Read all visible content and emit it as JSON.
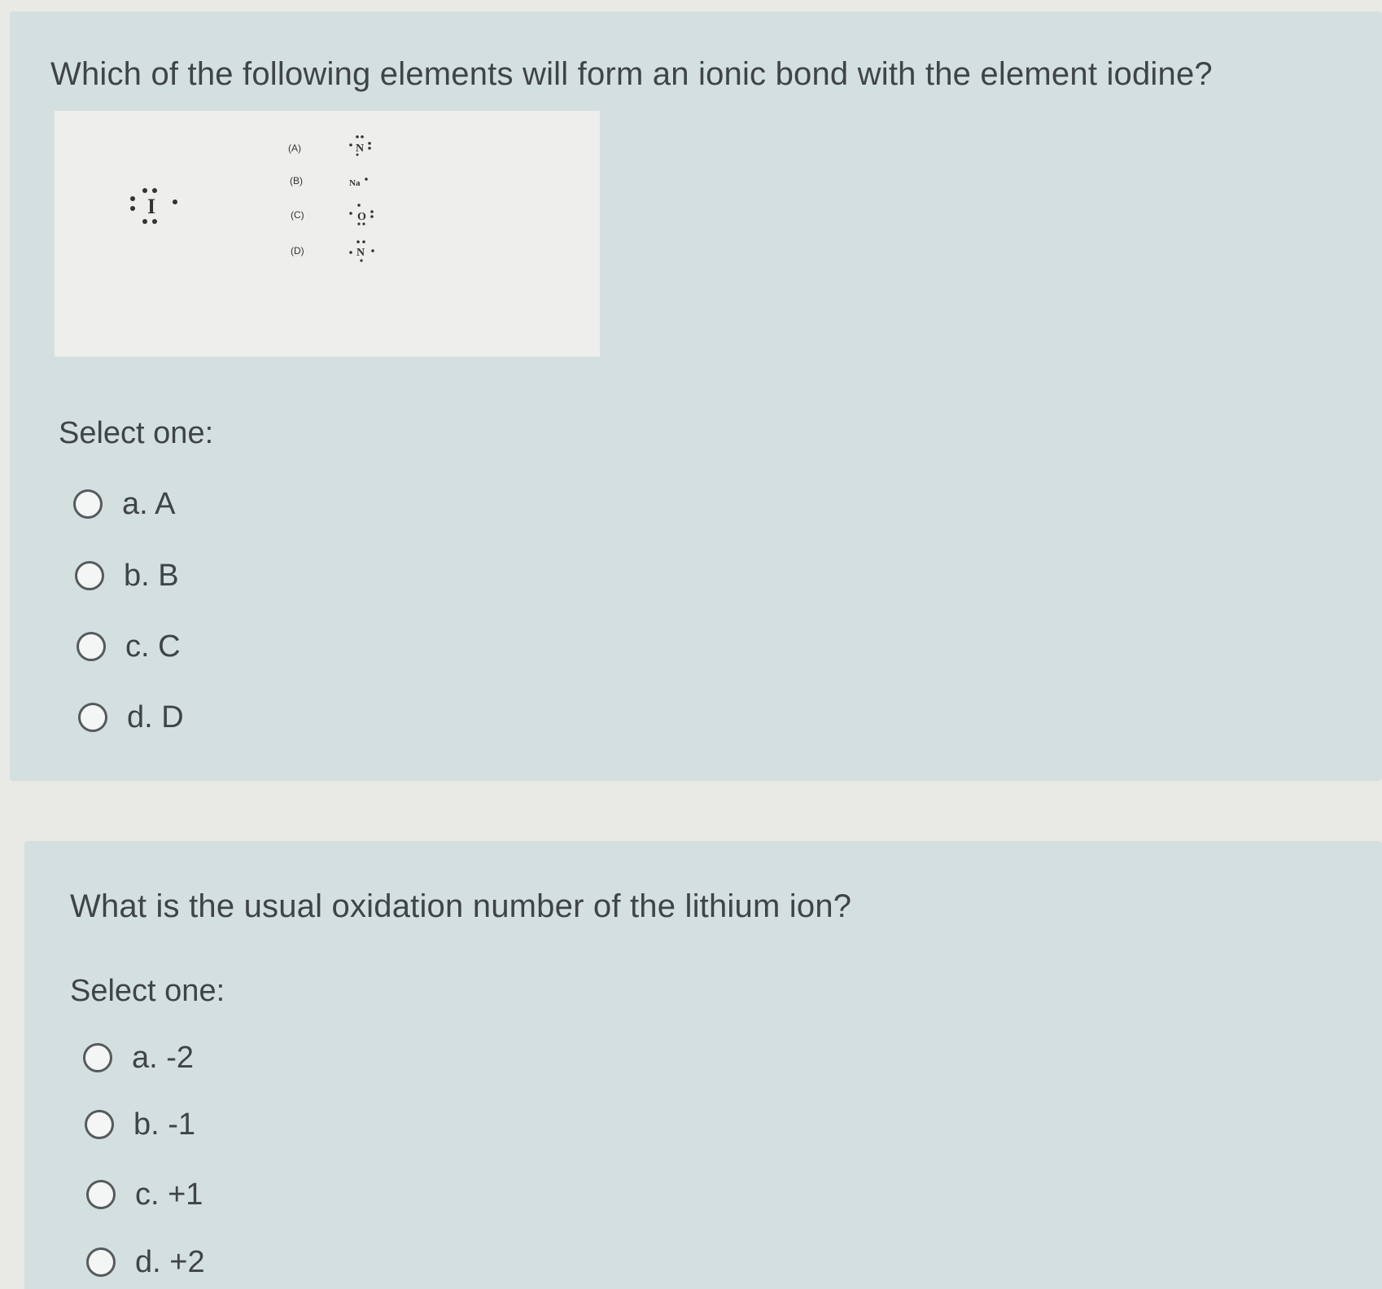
{
  "question1": {
    "text": "Which of the following elements will form an ionic bond with the element iodine?",
    "figure": {
      "iodine_symbol": "I",
      "choices": [
        {
          "label": "(A)",
          "symbol": "N"
        },
        {
          "label": "(B)",
          "symbol": "Na"
        },
        {
          "label": "(C)",
          "symbol": "O"
        },
        {
          "label": "(D)",
          "symbol": "N"
        }
      ]
    },
    "select_label": "Select one:",
    "options": [
      "a. A",
      "b. B",
      "c. C",
      "d. D"
    ]
  },
  "question2": {
    "text": "What is the usual oxidation number of the lithium ion?",
    "select_label": "Select one:",
    "options": [
      "a. -2",
      "b. -1",
      "c. +1",
      "d. +2"
    ]
  }
}
